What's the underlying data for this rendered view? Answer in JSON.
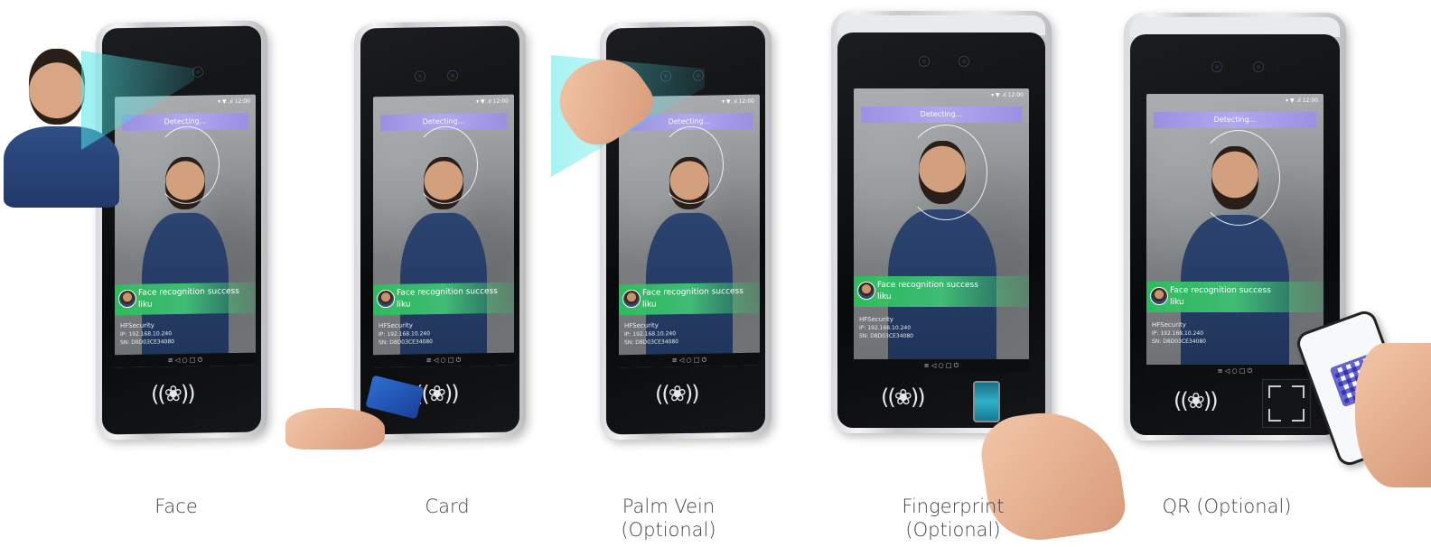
{
  "screen": {
    "status": "▾ ▼ .ıl 12:00",
    "detecting": "Detecting...",
    "success_line1": "Face recognition success",
    "success_line2": "liku",
    "company": "HFSecurity",
    "info1": "IP: 192.168.10.240",
    "info2": "SN: D8D03CE34080",
    "nav": "≡  ◁  ○  □  ⏻",
    "nfc": "((❀))"
  },
  "captions": {
    "face": "Face",
    "card": "Card",
    "palm_l1": "Palm Vein",
    "palm_l2": "(Optional)",
    "finger_l1": "Fingerprint",
    "finger_l2": "(Optional)",
    "qr": "QR (Optional)"
  }
}
